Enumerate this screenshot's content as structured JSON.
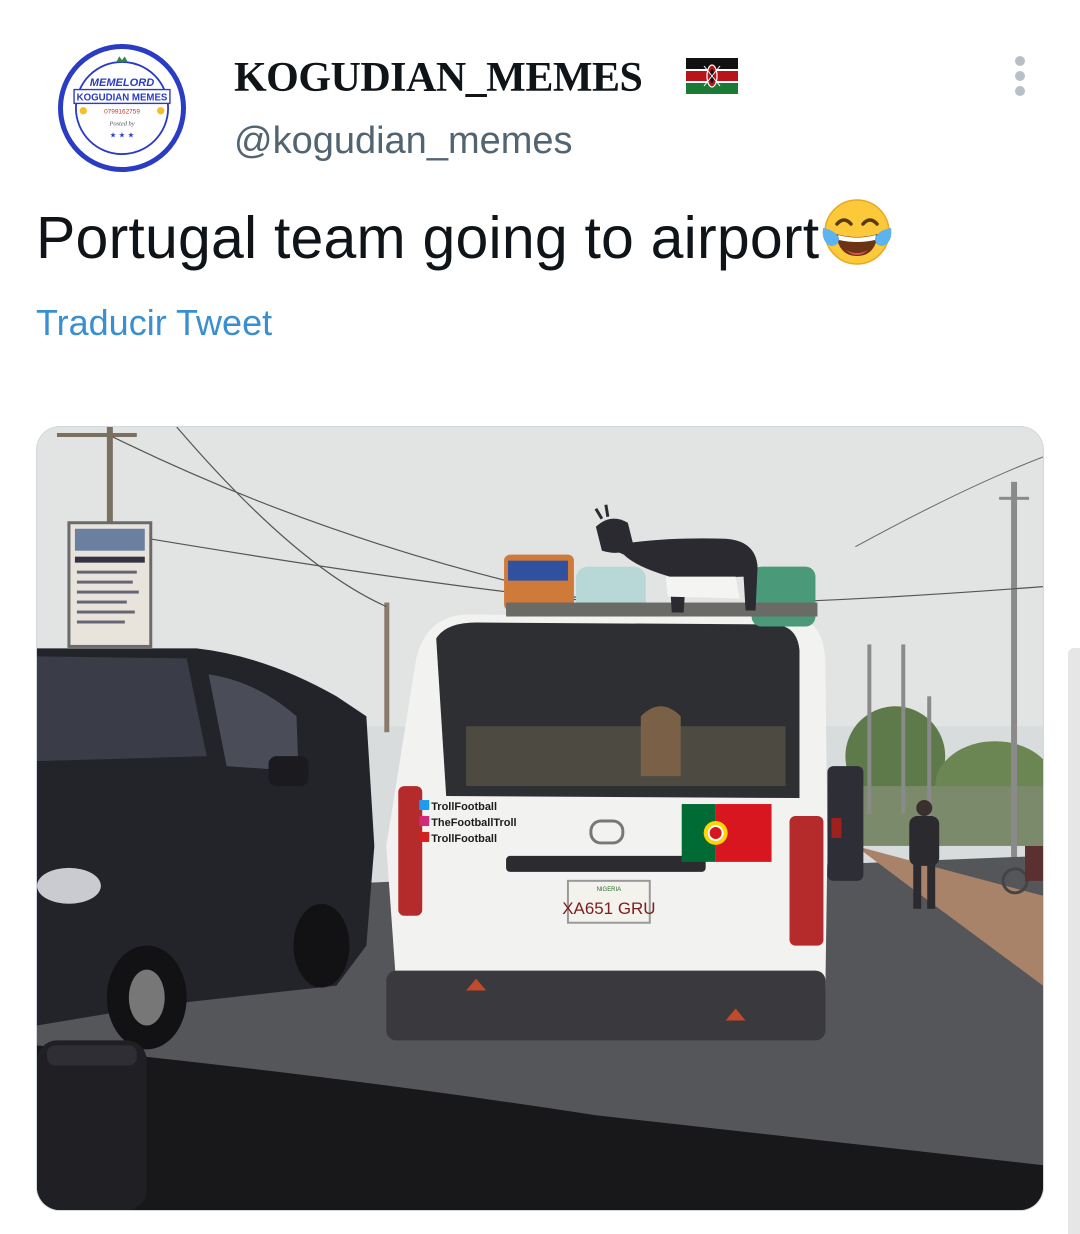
{
  "account": {
    "display_name": "KOGUDIAN_MEMES",
    "handle": "@kogudian_memes",
    "flag_icon": "kenya-flag-icon",
    "avatar": {
      "line1": "MEMELORD",
      "line2": "KOGUDIAN MEMES",
      "line3": "0799162759",
      "line4": "Posted by"
    }
  },
  "tweet": {
    "text": "Portugal team going to airport",
    "emoji_icon": "tears-of-joy-emoji-icon",
    "translate_label": "Traducir Tweet"
  },
  "media": {
    "watermark_lines": [
      "TrollFootball",
      "TheFootballTroll",
      "TrollFootball"
    ],
    "plate": "XA651 GRU",
    "plate_top": "NIGERIA"
  },
  "menu": {
    "icon": "more-options-icon"
  },
  "colors": {
    "link": "#3a8fd0",
    "handle_gray": "#536471",
    "avatar_ring": "#2a3bc4"
  }
}
